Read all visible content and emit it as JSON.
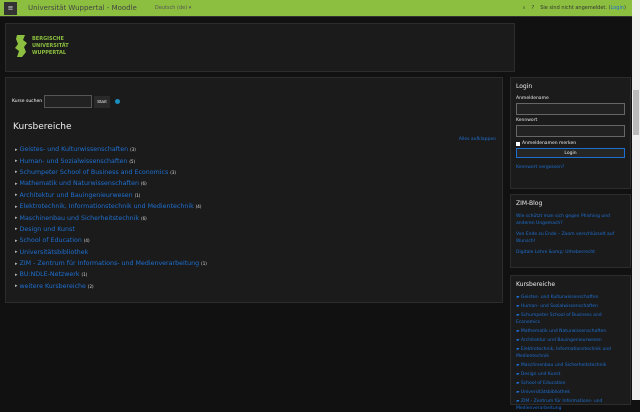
{
  "nav": {
    "menu_icon": "hamburger-icon",
    "title": "Universität Wuppertal - Moodle",
    "language": "Deutsch (de) ▾",
    "search_icon": "search-icon",
    "help_icon": "question-icon",
    "status": "Sie sind nicht angemeldet.",
    "login_link": "Login"
  },
  "logo": {
    "lines": [
      "BERGISCHE",
      "UNIVERSITÄT",
      "WUPPERTAL"
    ],
    "color": "#8cbf3f"
  },
  "main": {
    "search_label": "Kurse suchen",
    "search_value": "",
    "search_button": "Start",
    "heading": "Kursbereiche",
    "expand_all": "Alles aufklappen",
    "categories": [
      {
        "name": "Geistes- und Kulturwissenschaften",
        "count": "(3)"
      },
      {
        "name": "Human- und Sozialwissenschaften",
        "count": "(5)"
      },
      {
        "name": "Schumpeter School of Business and Economics",
        "count": "(3)"
      },
      {
        "name": "Mathematik und Naturwissenschaften",
        "count": "(6)"
      },
      {
        "name": "Architektur und Bauingenieurwesen",
        "count": "(1)"
      },
      {
        "name": "Elektrotechnik, Informationstechnik und Medientechnik",
        "count": "(4)"
      },
      {
        "name": "Maschinenbau und Sicherheitstechnik",
        "count": "(6)"
      },
      {
        "name": "Design und Kunst",
        "count": ""
      },
      {
        "name": "School of Education",
        "count": "(4)"
      },
      {
        "name": "Universitätsbibliothek",
        "count": ""
      },
      {
        "name": "ZIM - Zentrum für Informations- und Medienverarbeitung",
        "count": "(1)"
      },
      {
        "name": "BU:NDLE-Netzwerk",
        "count": "(1)"
      },
      {
        "name": "weitere Kursbereiche",
        "count": "(2)"
      }
    ]
  },
  "login": {
    "title": "Login",
    "username_label": "Anmeldename",
    "password_label": "Kennwort",
    "remember": "Anmeldenamen merken",
    "button": "Login",
    "forgot": "Kennwort vergessen?"
  },
  "blog": {
    "title": "ZIM-Blog",
    "posts": [
      "Wie schützt man sich gegen Phishing und anderen Ungemach?",
      "Von Ende zu Ende – Zoom verschlüsselt auf Wunsch!",
      "Digitale Lehre &amp; Urheberrecht"
    ]
  },
  "side_categories": {
    "title": "Kursbereiche",
    "items": [
      "Geistes- und Kulturwissenschaften",
      "Human- und Sozialwissenschaften",
      "Schumpeter School of Business and Economics",
      "Mathematik und Naturwissenschaften",
      "Architektur und Bauingenieurwesen",
      "Elektrotechnik, Informationstechnik und Medientechnik",
      "Maschinenbau und Sicherheitstechnik",
      "Design und Kunst",
      "School of Education",
      "Universitätsbibliothek",
      "ZIM - Zentrum für Informations- und Medienverarbeitung"
    ]
  }
}
